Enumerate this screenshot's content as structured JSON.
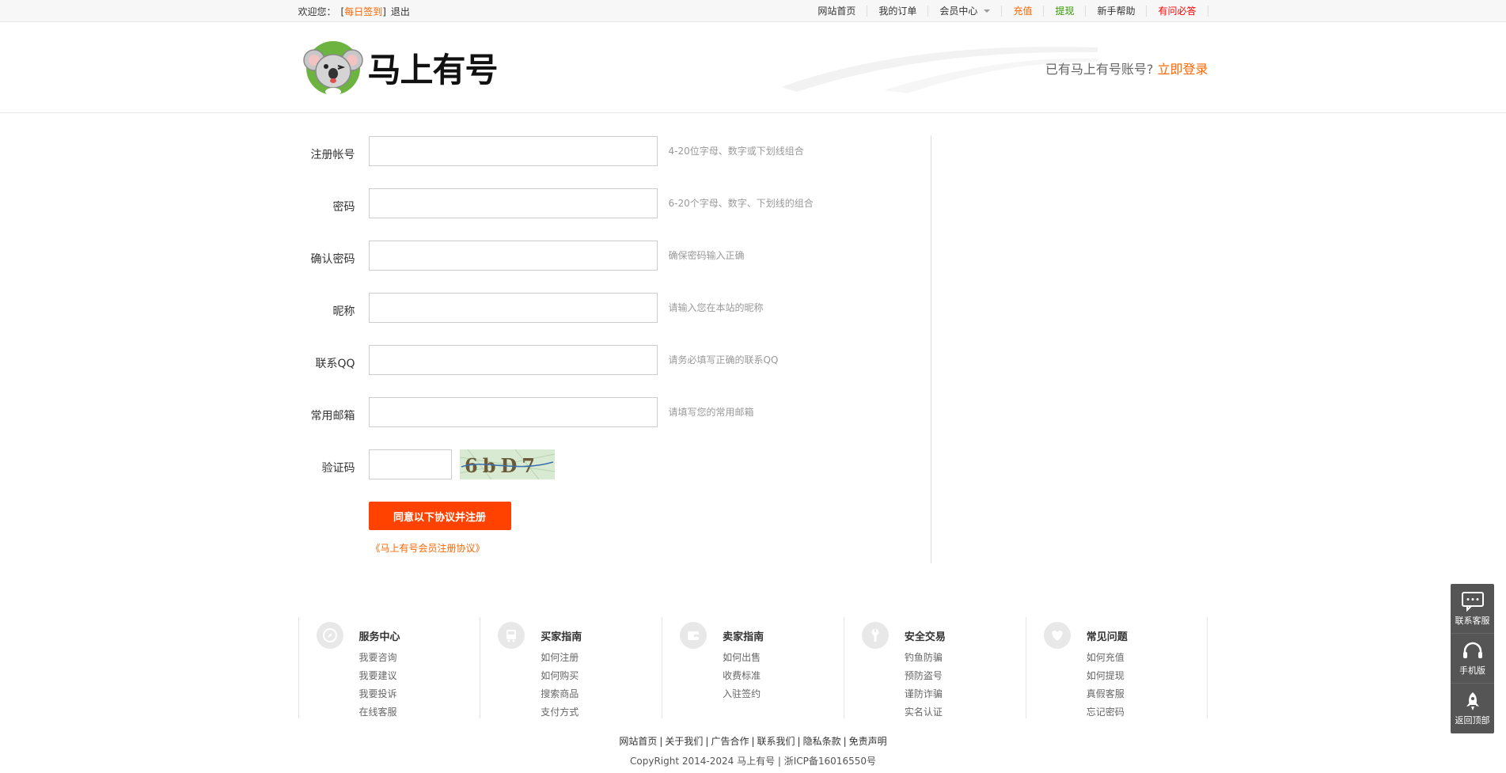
{
  "topbar": {
    "welcome": "欢迎您：",
    "bracket_open": "[",
    "checkin": "每日签到",
    "bracket_close": "]",
    "logout": "退出",
    "nav": [
      {
        "label": "网站首页",
        "color": "#333333"
      },
      {
        "label": "我的订单",
        "color": "#333333"
      },
      {
        "label": "会员中心",
        "color": "#333333"
      },
      {
        "label": "充值",
        "color": "#ff6600"
      },
      {
        "label": "提现",
        "color": "#339900"
      },
      {
        "label": "新手帮助",
        "color": "#333333"
      },
      {
        "label": "有问必答",
        "color": "#ff0000"
      }
    ]
  },
  "header": {
    "logo_text": "马上有号",
    "login_prompt": "已有马上有号账号?",
    "login_link": "立即登录"
  },
  "form": {
    "fields": [
      {
        "label": "注册帐号",
        "hint": "4-20位字母、数字或下划线组合",
        "value": ""
      },
      {
        "label": "密码",
        "hint": "6-20个字母、数字、下划线的组合",
        "value": ""
      },
      {
        "label": "确认密码",
        "hint": "确保密码输入正确",
        "value": ""
      },
      {
        "label": "昵称",
        "hint": "请输入您在本站的昵称",
        "value": ""
      },
      {
        "label": "联系QQ",
        "hint": "请务必填写正确的联系QQ",
        "value": ""
      },
      {
        "label": "常用邮箱",
        "hint": "请填写您的常用邮箱",
        "value": ""
      }
    ],
    "captcha_label": "验证码",
    "captcha_text": "6bD7",
    "submit_label": "同意以下协议并注册",
    "agreement_link": "《马上有号会员注册协议》"
  },
  "help": [
    {
      "title": "服务中心",
      "icon": "compass-icon",
      "links": [
        "我要咨询",
        "我要建议",
        "我要投诉",
        "在线客服"
      ]
    },
    {
      "title": "买家指南",
      "icon": "bus-icon",
      "links": [
        "如何注册",
        "如何购买",
        "搜索商品",
        "支付方式"
      ]
    },
    {
      "title": "卖家指南",
      "icon": "wallet-icon",
      "links": [
        "如何出售",
        "收费标准",
        "入驻签约"
      ]
    },
    {
      "title": "安全交易",
      "icon": "wrench-icon",
      "links": [
        "钓鱼防骗",
        "预防盗号",
        "谨防诈骗",
        "实名认证"
      ]
    },
    {
      "title": "常见问题",
      "icon": "heart-icon",
      "links": [
        "如何充值",
        "如何提现",
        "真假客服",
        "忘记密码"
      ]
    }
  ],
  "footer": {
    "links": [
      "网站首页",
      "关于我们",
      "广告合作",
      "联系我们",
      "隐私条款",
      "免责声明"
    ],
    "separator": "|",
    "copyright": "CopyRight 2014-2024 马上有号 | 浙ICP备16016550号"
  },
  "side": [
    {
      "label": "联系客服",
      "icon": "chat-icon"
    },
    {
      "label": "手机版",
      "icon": "headset-icon"
    },
    {
      "label": "返回顶部",
      "icon": "rocket-icon"
    }
  ],
  "colors": {
    "accent": "#ff6600",
    "submit": "#ff4200",
    "green": "#339900",
    "red": "#ff0000"
  }
}
